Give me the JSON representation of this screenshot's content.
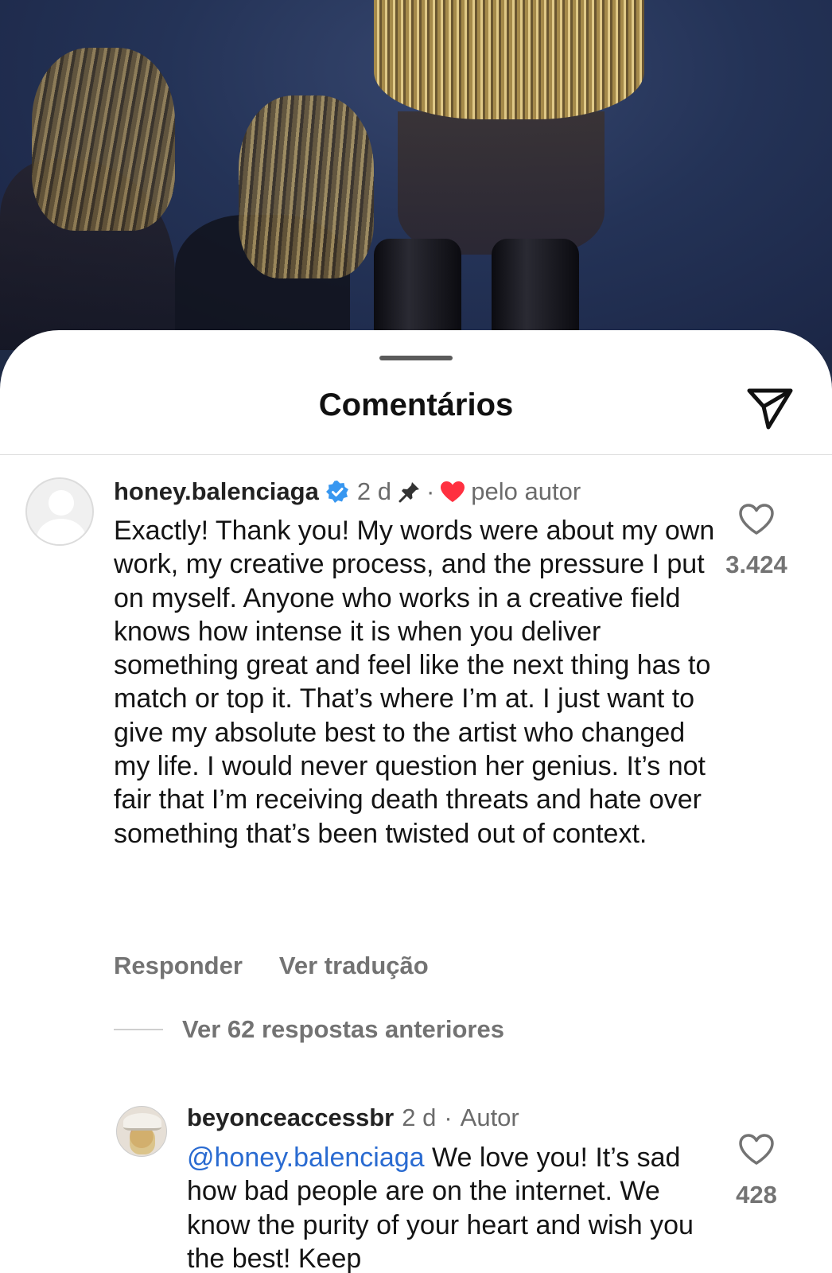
{
  "sheet": {
    "title": "Comentários",
    "share_icon": "paper-plane-icon"
  },
  "comments": [
    {
      "username": "honey.balenciaga",
      "verified": true,
      "time": "2 d",
      "pinned": true,
      "separator": "·",
      "liked_by_author_label": "pelo autor",
      "text": "Exactly! Thank you! My words were about my own work, my creative process, and the pressure I put on myself. Anyone who works in a creative field knows how intense it is when you deliver something great and feel like the next thing has to match or top it. That’s where I’m at. I just want to give my absolute best to the artist who changed my life. I would never question her genius. It’s not fair that I’m receiving death threats and hate over something that’s been twisted out of context.",
      "like_count": "3.424",
      "reply_label": "Responder",
      "translate_label": "Ver tradução",
      "view_replies_label": "Ver 62 respostas anteriores"
    },
    {
      "username": "beyonceaccessbr",
      "time": "2 d",
      "separator": "·",
      "author_label": "Autor",
      "mention": "@honey.balenciaga",
      "text": "We love you! It’s sad how bad people are on the internet. We know the purity of your heart and wish you the best! Keep",
      "like_count": "428"
    }
  ],
  "colors": {
    "accent_link": "#2a6bd1",
    "heart_red": "#ff3040",
    "verified_blue": "#3897f0",
    "muted_text": "#737373"
  }
}
